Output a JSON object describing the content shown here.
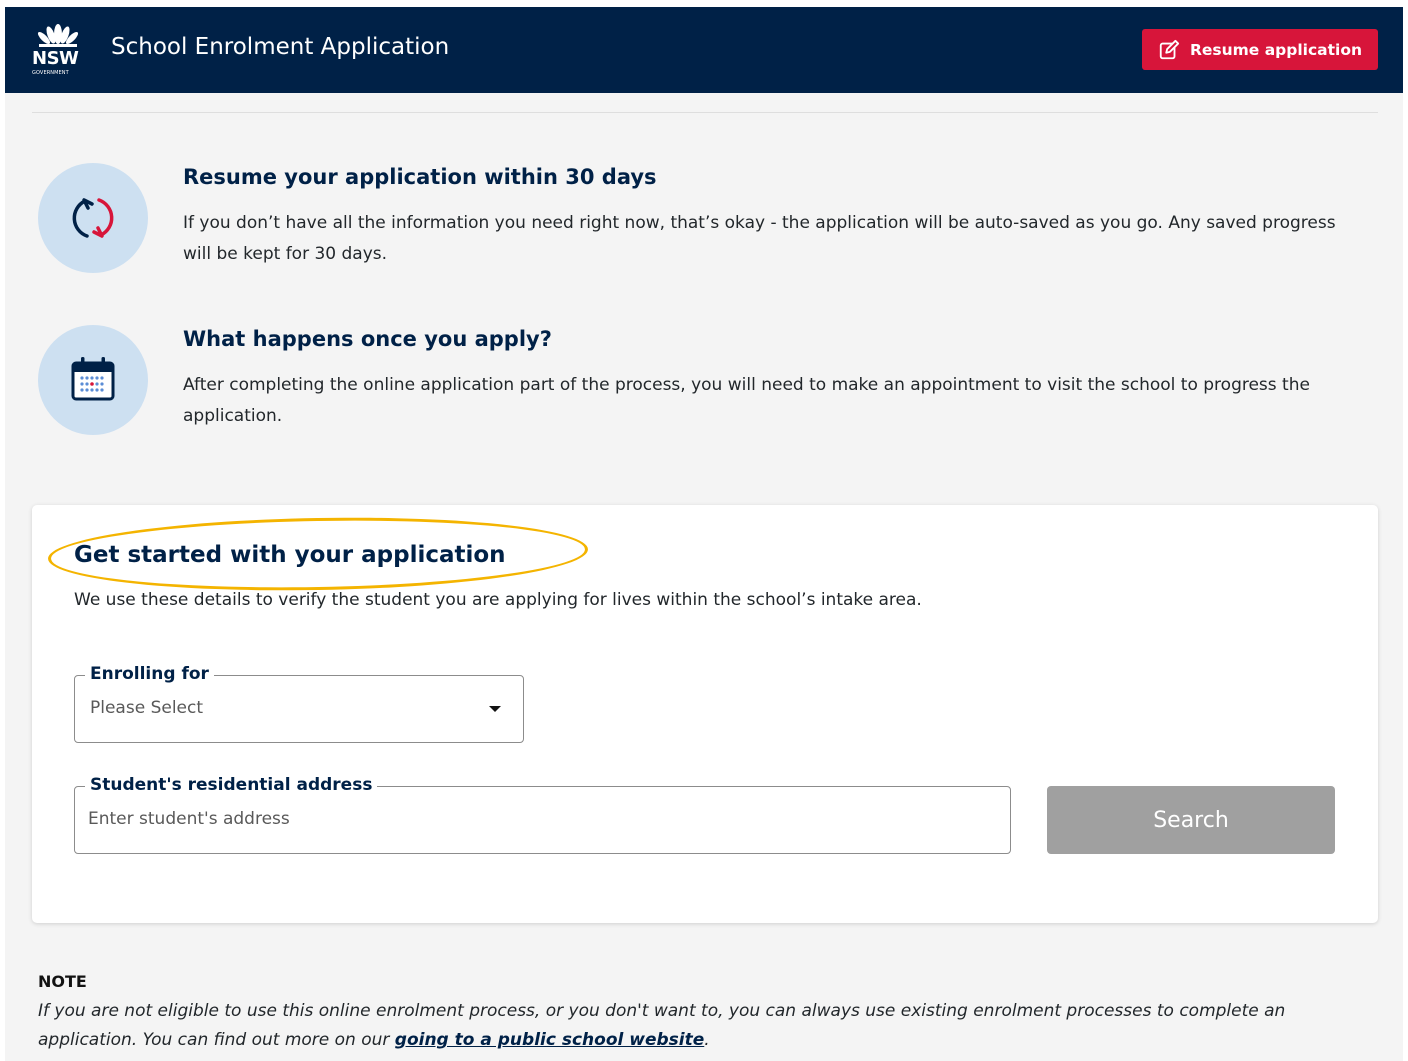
{
  "colors": {
    "header_bg": "#002147",
    "accent_red": "#d7153a",
    "icon_circle": "#cde0f1",
    "highlight_oval": "#f4b400",
    "search_disabled": "#a0a0a0"
  },
  "header": {
    "logo_text": "NSW",
    "logo_subtext": "GOVERNMENT",
    "title": "School Enrolment Application",
    "resume_button": {
      "label": "Resume application",
      "icon": "edit-icon"
    }
  },
  "info_blocks": [
    {
      "icon": "refresh-icon",
      "heading": "Resume your application within 30 days",
      "text": "If you don’t have all the information you need right now, that’s okay - the application will be auto-saved as you go. Any saved progress will be kept for 30 days."
    },
    {
      "icon": "calendar-icon",
      "heading": "What happens once you apply?",
      "text": "After completing the online application part of the process, you will need to make an appointment to visit the school to progress the application."
    }
  ],
  "form_card": {
    "title": "Get started with your application",
    "description": "We use these details to verify the student you are applying for lives within the school’s intake area.",
    "enrolling_for": {
      "label": "Enrolling for",
      "value": "Please Select"
    },
    "address": {
      "label": "Student's residential address",
      "placeholder": "Enter student's address"
    },
    "search_button": "Search"
  },
  "note": {
    "title": "NOTE",
    "text_before": "If you are not eligible to use this online enrolment process, or you don't want to, you can always use existing enrolment processes to complete an application. You can find out more on our ",
    "link_text": "going to a public school website",
    "text_after": "."
  }
}
